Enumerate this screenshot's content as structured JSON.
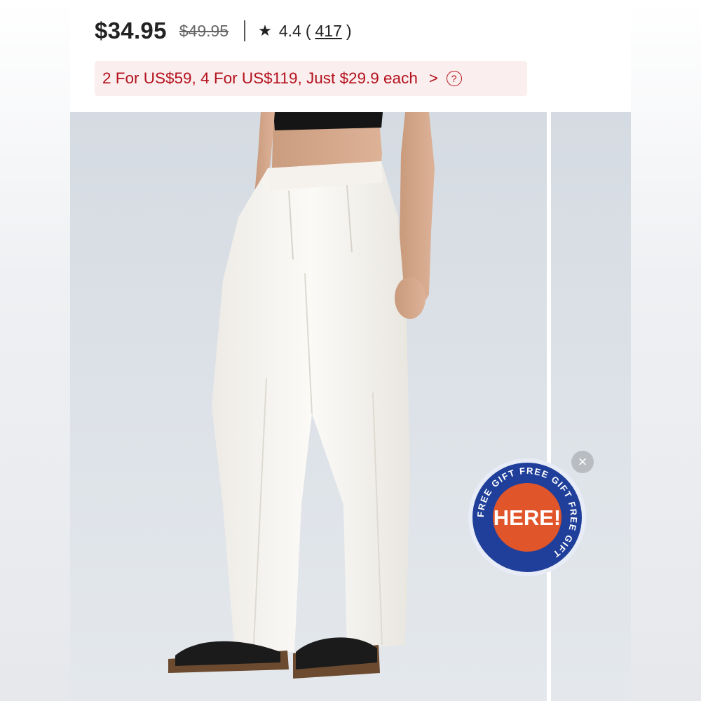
{
  "product": {
    "price": "$34.95",
    "original_price": "$49.95",
    "rating": "4.4",
    "review_count": "417",
    "paren_open": "(",
    "paren_close": ")"
  },
  "promo": {
    "text": "2 For US$59, 4 For US$119, Just $29.9 each",
    "chevron": ">",
    "help": "?"
  },
  "gift_badge": {
    "ring_text": "FREE GIFT FREE GIFT FREE GIFT",
    "center_text": "HERE!",
    "close": "×"
  },
  "colors": {
    "price_text": "#222222",
    "promo_text": "#b3121d",
    "promo_bg": "#fbeeee",
    "badge_ring": "#1f3f9a",
    "badge_center": "#e0552a"
  },
  "icons": {
    "rating": "star-icon",
    "promo_more": "chevron-right-icon",
    "promo_help": "help-circle-icon",
    "badge_close": "close-icon"
  }
}
